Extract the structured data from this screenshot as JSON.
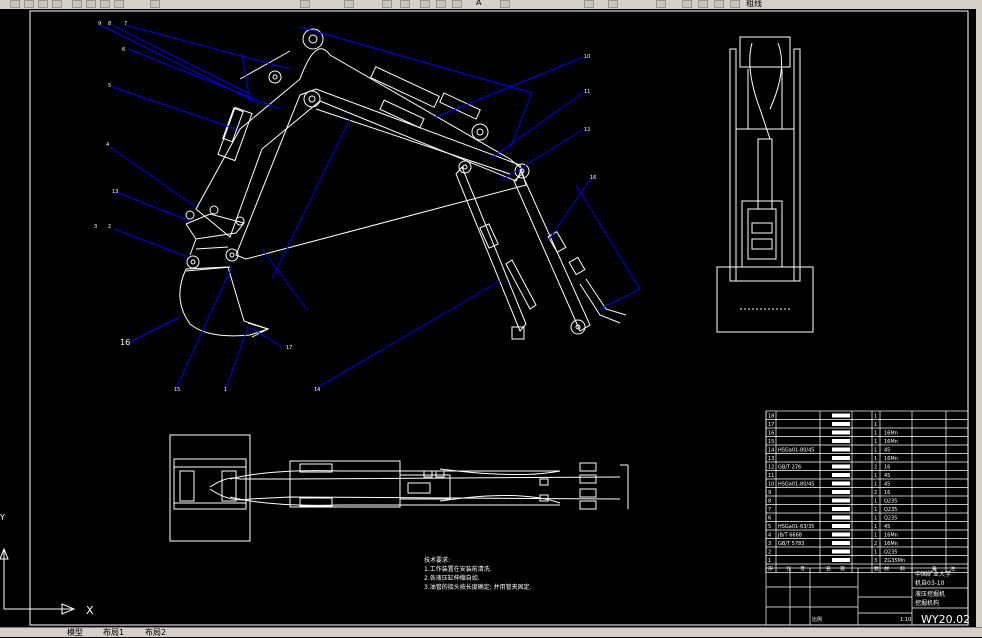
{
  "toolbar": {
    "layer_name": "粗线",
    "text_icon_label": "A"
  },
  "tabs": [
    "模型",
    "布局1",
    "布局2"
  ],
  "ucs": {
    "x_label": "X",
    "y_label": "Y"
  },
  "callouts": [
    "1",
    "2",
    "3",
    "4",
    "5",
    "6",
    "7",
    "8",
    "9",
    "10",
    "11",
    "12",
    "13",
    "14",
    "15",
    "16",
    "17"
  ],
  "callout_big": "16",
  "tech_req": {
    "title": "技术要求:",
    "lines": [
      "1.工作装置在安装前清洗.",
      "2.各液压缸伸缩自如.",
      "3.油管的接头按长度确定; 并用管夹固定."
    ]
  },
  "bom": {
    "rows": [
      {
        "no": "18",
        "qty": "1"
      },
      {
        "no": "17",
        "qty": "1"
      },
      {
        "no": "16",
        "qty": "1",
        "mat": "16Mn"
      },
      {
        "no": "15",
        "qty": "1",
        "mat": "16Mn"
      },
      {
        "no": "14",
        "code": "HSGa01-80/45",
        "qty": "1",
        "mat": "45"
      },
      {
        "no": "13",
        "qty": "1",
        "mat": "16Mn"
      },
      {
        "no": "12",
        "code": "GB/T 276",
        "qty": "2",
        "mat": "16"
      },
      {
        "no": "11",
        "qty": "1",
        "mat": "45"
      },
      {
        "no": "10",
        "code": "HSGa01-80/45",
        "qty": "1",
        "mat": "45"
      },
      {
        "no": "9",
        "qty": "2",
        "mat": "16"
      },
      {
        "no": "8",
        "qty": "1",
        "mat": "Q235"
      },
      {
        "no": "7",
        "qty": "1",
        "mat": "Q235"
      },
      {
        "no": "6",
        "qty": "1",
        "mat": "Q235"
      },
      {
        "no": "5",
        "code": "HSGa01-63/35",
        "qty": "1",
        "mat": "45"
      },
      {
        "no": "4",
        "code": "JB/T 6668",
        "qty": "1",
        "mat": "16Mn"
      },
      {
        "no": "3",
        "code": "GB/T 5783",
        "qty": "2",
        "mat": "16Mn"
      },
      {
        "no": "2",
        "qty": "1",
        "mat": "Q235"
      },
      {
        "no": "1",
        "qty": "3",
        "mat": "ZG35Mn"
      }
    ],
    "header": [
      "序",
      "代",
      "号",
      "名",
      "称",
      "数",
      "材",
      "料",
      "备",
      "注"
    ]
  },
  "title_block": {
    "school_line1": "中国矿业大学",
    "school_line2": "机自03-10",
    "drawing_name_line1": "液压挖掘机",
    "drawing_name_line2": "挖掘机构",
    "drawing_no": "WY20.02",
    "scale": "1:10",
    "sheet_label": "比例"
  },
  "colors": {
    "blue": "#0000ff",
    "white": "#ffffff",
    "background": "#000000",
    "toolbar": "#d4d0c8"
  }
}
